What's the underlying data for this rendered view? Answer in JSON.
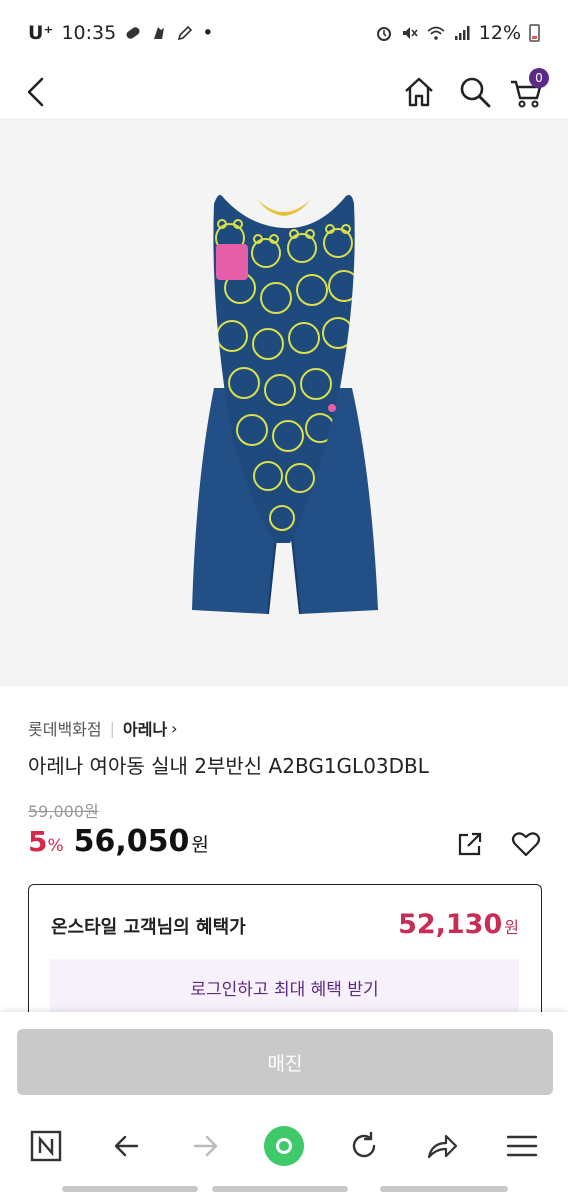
{
  "status_bar": {
    "carrier": "U⁺",
    "time": "10:35",
    "battery": "12%"
  },
  "header": {
    "cart_count": "0"
  },
  "product": {
    "store": "롯데백화점",
    "brand": "아레나",
    "brand_chevron": "›",
    "title": "아레나 여아동 실내 2부반신 A2BG1GL03DBL",
    "original_price": "59,000원",
    "discount_rate": "5",
    "discount_unit": "%",
    "price": "56,050",
    "price_unit": "원"
  },
  "benefit": {
    "label": "온스타일 고객님의 혜택가",
    "price": "52,130",
    "price_unit": "원",
    "login_button": "로그인하고 최대 혜택 받기"
  },
  "bottom": {
    "soldout_button": "매진"
  },
  "colors": {
    "brand_purple": "#5b2a86",
    "discount_red": "#d6284c",
    "benefit_red": "#c72d55",
    "soldout_gray": "#c9c9c9",
    "swimsuit_navy": "#1f4f8a",
    "bear_line_yellow": "#d8e04a",
    "nav_green": "#3ec96a"
  },
  "icons": {
    "status": [
      "alarm-icon",
      "mute-icon",
      "wifi-icon",
      "signal-icon",
      "battery-icon"
    ],
    "header": [
      "back-arrow-icon",
      "home-icon",
      "search-icon",
      "cart-icon"
    ],
    "actions": [
      "share-icon",
      "heart-icon"
    ],
    "browser_nav": [
      "naver-n-icon",
      "nav-back-icon",
      "nav-forward-icon",
      "green-dot-icon",
      "refresh-icon",
      "share-arrow-icon",
      "menu-icon"
    ]
  }
}
